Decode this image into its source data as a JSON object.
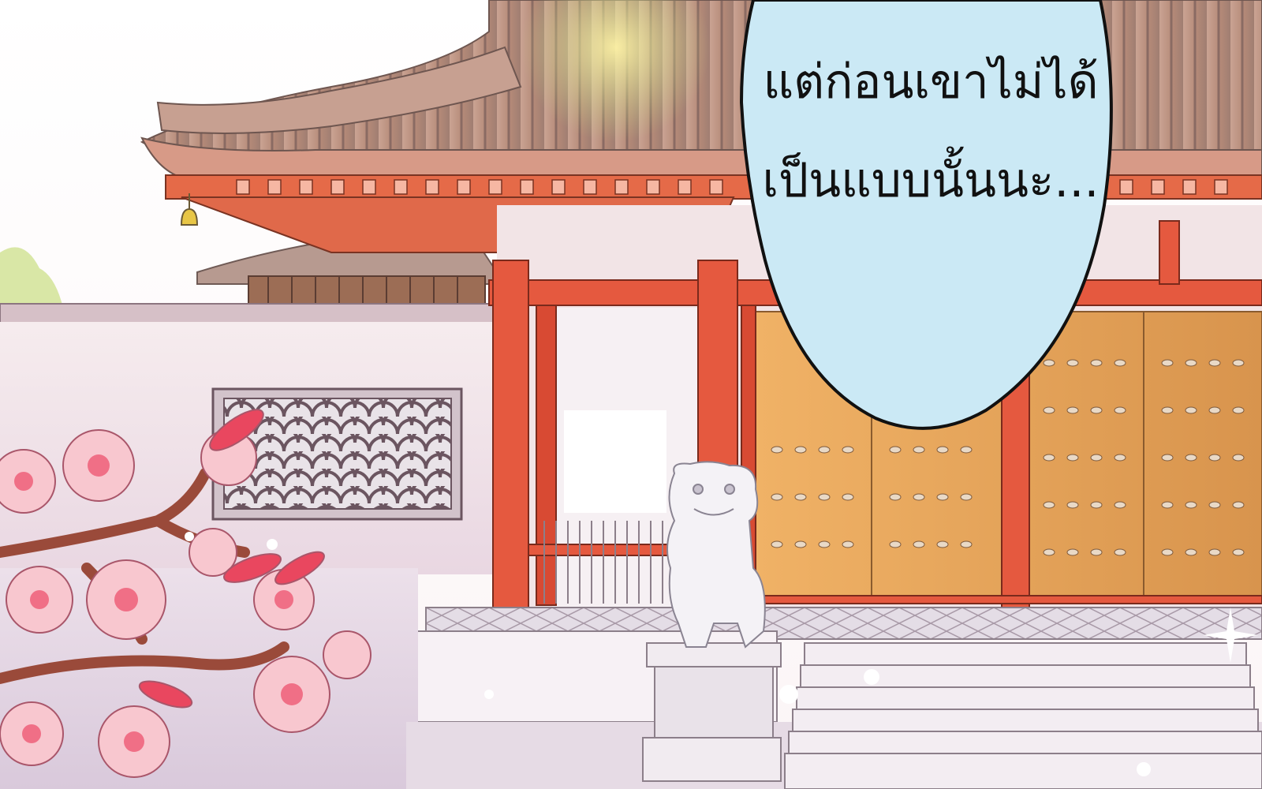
{
  "speech_bubble": {
    "lines": [
      "แต่ก่อนเขาไม่ได้",
      "เป็นแบบนั้นนะ..."
    ],
    "fill_color": "#cbe9f5",
    "outline_color": "#111111"
  },
  "scene": {
    "description_icon": "palace-courtyard-illustration",
    "sky_color": "#ffffff",
    "pillar_color": "#e5593f",
    "door_color": "#e8a75a",
    "roof_color": "#b98c7c",
    "wall_color": "#f3e6ea",
    "blossom_color": "#f5a8b6"
  }
}
